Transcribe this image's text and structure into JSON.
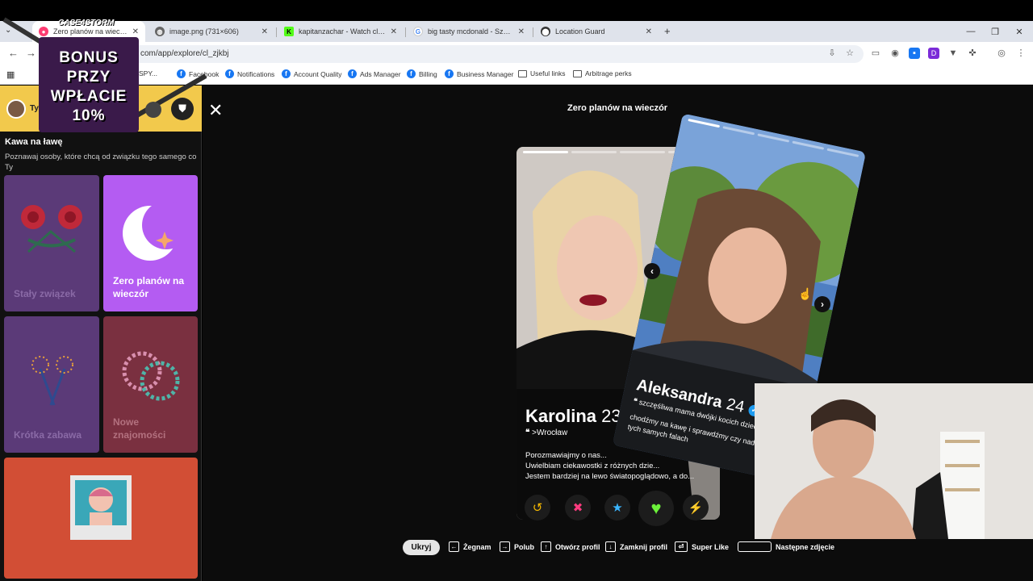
{
  "browser": {
    "tabs": [
      {
        "title": "Zero planów na wieczór | Tinder",
        "favicon": "tinder-flame-icon",
        "active": true
      },
      {
        "title": "image.png (731×606)",
        "favicon": "globe-icon",
        "active": false
      },
      {
        "title": "kapitanzachar - Watch clips on Kick",
        "favicon": "kick-icon",
        "active": false
      },
      {
        "title": "big tasty mcdonald - Szukaj w Google",
        "favicon": "google-icon",
        "active": false
      },
      {
        "title": "Location Guard",
        "favicon": "location-pin-icon",
        "active": false
      }
    ],
    "new_tab": "+",
    "url": "com/app/explore/cl_zjkbj",
    "bookmarks": [
      {
        "label": "SPY...",
        "icon": "facebook-icon"
      },
      {
        "label": "Facebook",
        "icon": "facebook-icon"
      },
      {
        "label": "Notifications",
        "icon": "facebook-icon"
      },
      {
        "label": "Account Quality",
        "icon": "facebook-icon"
      },
      {
        "label": "Ads Manager",
        "icon": "facebook-icon"
      },
      {
        "label": "Billing",
        "icon": "facebook-icon"
      },
      {
        "label": "Business Manager",
        "icon": "facebook-icon"
      },
      {
        "label": "Useful links",
        "icon": "folder-icon"
      },
      {
        "label": "Arbitrage perks",
        "icon": "folder-icon"
      }
    ]
  },
  "promo": {
    "logo": "CASE4STORM",
    "line1": "BONUS",
    "line2": "PRZY",
    "line3": "WPŁACIE",
    "line4": "10%"
  },
  "sidebar": {
    "user_label": "Ty",
    "section_title": "Kawa na ławę",
    "section_desc": "Poznawaj osoby, które chcą od związku tego samego co Ty",
    "cards": [
      {
        "label": "Stały związek",
        "color": "#5b3a78"
      },
      {
        "label": "Zero planów na wieczór",
        "color": "#b45cf2"
      },
      {
        "label": "Krótka zabawa",
        "color": "#5b3a78"
      },
      {
        "label": "Nowe znajomości",
        "color": "#7a3040"
      }
    ]
  },
  "stage": {
    "title": "Zero planów na wieczór",
    "close": "✕",
    "back_profile": {
      "name": "Karolina",
      "age": "23",
      "location": ">Wrocław",
      "bio_lines": [
        "Porozmawiajmy o nas...",
        "Uwielbiam ciekawostki z różnych dzie...",
        "Jestem bardziej na lewo światopoglądowo, a do..."
      ]
    },
    "front_profile": {
      "name": "Aleksandra",
      "age": "24",
      "quote": "szczęśliwa mama dwójki kocich dzieci",
      "bio": "chodźmy na kawę i sprawdźmy czy nadajemy na tych samych falach"
    },
    "actions": [
      {
        "name": "rewind",
        "glyph": "↺",
        "color": "#f5b800"
      },
      {
        "name": "nope",
        "glyph": "✖",
        "color": "#ff3b7f"
      },
      {
        "name": "super-like",
        "glyph": "★",
        "color": "#3ab5ff"
      },
      {
        "name": "like",
        "glyph": "♥",
        "color": "#6cf23a"
      },
      {
        "name": "boost",
        "glyph": "⚡",
        "color": "#b45cf2"
      }
    ]
  },
  "shortcuts": {
    "hide": "Ukryj",
    "items": [
      {
        "key": "←",
        "label": "Żegnam"
      },
      {
        "key": "→",
        "label": "Polub"
      },
      {
        "key": "↑",
        "label": "Otwórz profil"
      },
      {
        "key": "↓",
        "label": "Zamknij profil"
      },
      {
        "key": "⏎",
        "label": "Super Like"
      },
      {
        "key": "",
        "label": "Następne zdjęcie"
      }
    ]
  }
}
